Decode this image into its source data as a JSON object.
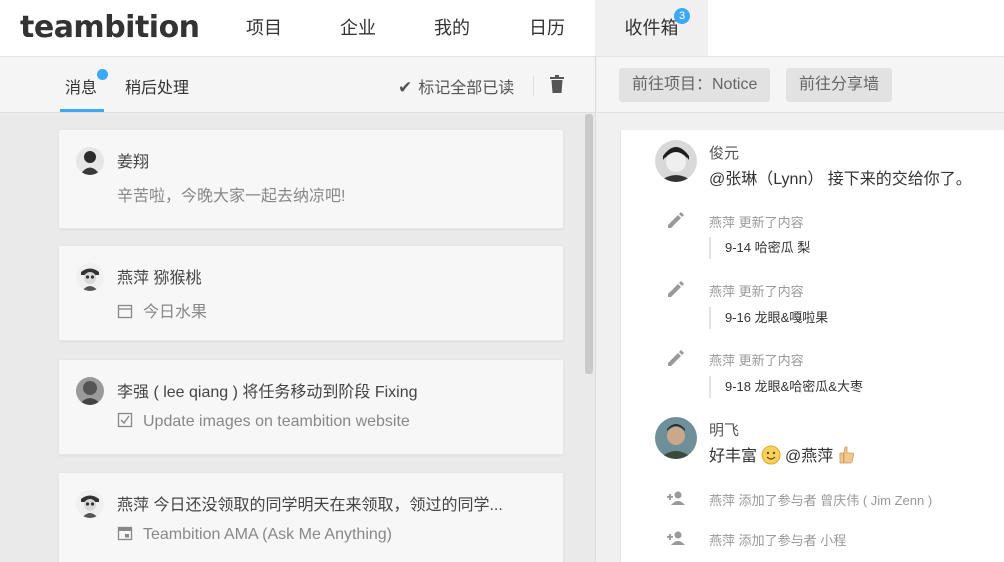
{
  "app": {
    "logo": "teambition"
  },
  "nav": {
    "items": [
      "项目",
      "企业",
      "我的",
      "日历",
      "收件箱"
    ],
    "inbox_badge": "3"
  },
  "left_toolbar": {
    "tab_messages": "消息",
    "tab_later": "稍后处理",
    "mark_all_read": "标记全部已读"
  },
  "messages": [
    {
      "title": "姜翔",
      "subtitle": "辛苦啦，今晚大家一起去纳凉吧!",
      "icon": ""
    },
    {
      "title": "燕萍 猕猴桃",
      "subtitle": "今日水果",
      "icon": "calendar-icon"
    },
    {
      "title": "李强 ( lee qiang ) 将任务移动到阶段 Fixing",
      "subtitle": "Update images on teambition website",
      "icon": "checkbox-icon"
    },
    {
      "title": "燕萍 今日还没领取的同学明天在来领取，领过的同学...",
      "subtitle": "Teambition AMA (Ask Me Anything)",
      "icon": "event-icon"
    }
  ],
  "right_toolbar": {
    "goto_project": "前往项目：Notice",
    "goto_share": "前往分享墙"
  },
  "activity": {
    "comment1": {
      "name": "俊元",
      "text": "@张琳（Lynn） 接下来的交给你了。"
    },
    "updates": [
      {
        "meta": "燕萍 更新了内容",
        "quote": "9-14  哈密瓜 梨"
      },
      {
        "meta": "燕萍 更新了内容",
        "quote": "9-16  龙眼&嘎啦果"
      },
      {
        "meta": "燕萍 更新了内容",
        "quote": "9-18  龙眼&哈密瓜&大枣"
      }
    ],
    "comment2": {
      "name": "明飞",
      "text_before": "好丰富",
      "text_after": "@燕萍"
    },
    "members": [
      {
        "meta": "燕萍 添加了参与者 曾庆伟 ( Jim Zenn )"
      },
      {
        "meta": "燕萍 添加了参与者 小程"
      }
    ]
  },
  "colors": {
    "accent": "#3da8f5"
  }
}
